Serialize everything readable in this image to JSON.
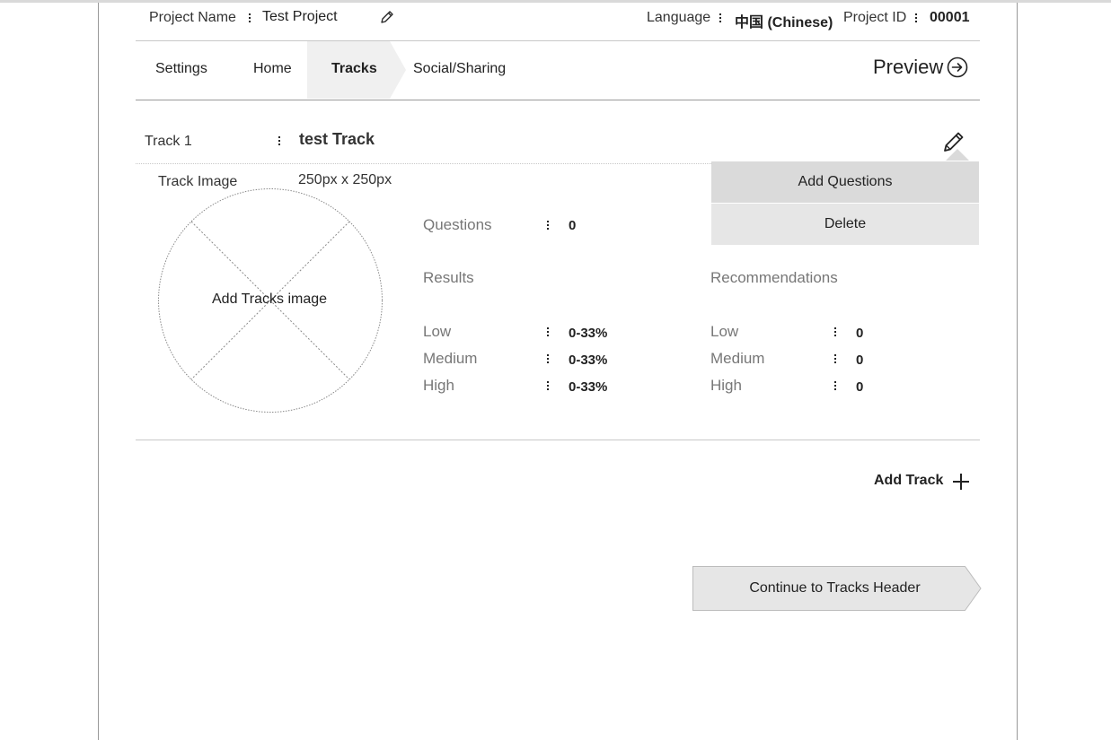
{
  "header": {
    "project_name_label": "Project Name",
    "project_name_value": "Test Project",
    "language_label": "Language",
    "language_value": "中国 (Chinese)",
    "project_id_label": "Project ID",
    "project_id_value": "00001"
  },
  "nav": {
    "tabs": [
      {
        "label": "Settings"
      },
      {
        "label": "Home"
      },
      {
        "label": "Tracks"
      },
      {
        "label": "Social/Sharing"
      }
    ],
    "active_tab": "Tracks",
    "preview_label": "Preview"
  },
  "track": {
    "label": "Track 1",
    "name": "test Track",
    "image_label": "Track Image",
    "image_size": "250px x 250px",
    "image_placeholder": "Add Tracks image",
    "questions_label": "Questions",
    "questions_value": "0",
    "results_title": "Results",
    "results": [
      {
        "label": "Low",
        "value": "0-33%"
      },
      {
        "label": "Medium",
        "value": "0-33%"
      },
      {
        "label": "High",
        "value": "0-33%"
      }
    ],
    "recommendations_title": "Recommendations",
    "recommendations": [
      {
        "label": "Low",
        "value": "0"
      },
      {
        "label": "Medium",
        "value": "0"
      },
      {
        "label": "High",
        "value": "0"
      }
    ]
  },
  "menu": {
    "add_questions": "Add Questions",
    "delete": "Delete"
  },
  "actions": {
    "add_track": "Add Track",
    "continue": "Continue to Tracks Header"
  },
  "icons": {
    "edit": "pencil-icon",
    "preview": "arrow-right-circle-icon",
    "add": "plus-icon"
  },
  "colors": {
    "active_tab_bg": "#f0f0f0",
    "menu_bg": "#dadada",
    "menu_bg_alt": "#e6e6e6",
    "continue_bg": "#e6e6e6"
  }
}
